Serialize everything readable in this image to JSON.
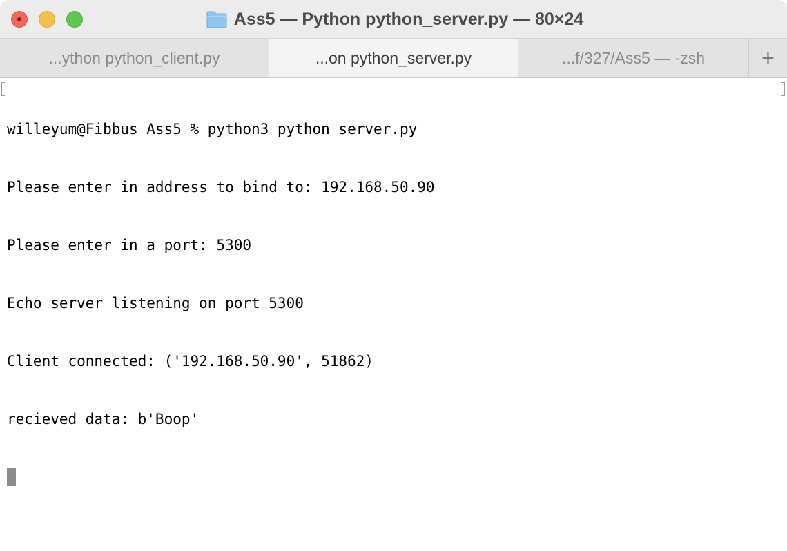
{
  "window": {
    "title": "Ass5 — Python python_server.py — 80×24",
    "icon": "folder-icon",
    "controls": [
      "close-icon",
      "minimize-icon",
      "zoom-icon"
    ]
  },
  "tabs": [
    {
      "label": "...ython python_client.py",
      "active": false
    },
    {
      "label": "...on python_server.py",
      "active": true
    },
    {
      "label": "...f/327/Ass5 — -zsh",
      "active": false
    }
  ],
  "new_tab_label": "+",
  "terminal": {
    "lines": [
      "willeyum@Fibbus Ass5 % python3 python_server.py",
      "Please enter in address to bind to: 192.168.50.90",
      "Please enter in a port: 5300",
      "Echo server listening on port 5300",
      "Client connected: ('192.168.50.90', 51862)",
      "recieved data: b'Boop'"
    ]
  },
  "colors": {
    "close": "#ed6a5e",
    "minimize": "#f5bf4f",
    "zoom": "#61c554",
    "folder": "#8ec6ee",
    "cursor": "#8c8c8c"
  }
}
